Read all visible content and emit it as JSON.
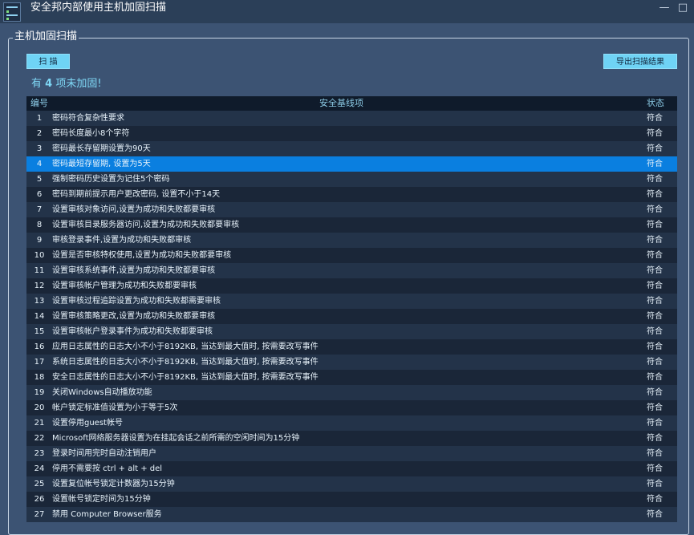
{
  "window": {
    "title": "安全邦内部使用主机加固扫描",
    "minimize_glyph": "—",
    "maximize_glyph": "□"
  },
  "icons": {
    "app": "app-shield-list-icon"
  },
  "colors": {
    "background": "#3c5373",
    "titlebar": "#2b3f58",
    "accent_button": "#6fd3f5",
    "selected_row": "#0a7fe0",
    "summary_text": "#7fd8f6"
  },
  "group": {
    "title": "主机加固扫描"
  },
  "toolbar": {
    "scan_label": "扫  描",
    "export_label": "导出扫描结果"
  },
  "summary": {
    "prefix": "有 ",
    "count": "4",
    "suffix": " 项未加固!"
  },
  "table": {
    "headers": {
      "no": "编号",
      "item": "安全基线项",
      "status": "状态"
    },
    "selected_index": 3,
    "rows": [
      {
        "no": "1",
        "item": "密码符合复杂性要求",
        "status": "符合"
      },
      {
        "no": "2",
        "item": "密码长度最小8个字符",
        "status": "符合"
      },
      {
        "no": "3",
        "item": "密码最长存留期设置为90天",
        "status": "符合"
      },
      {
        "no": "4",
        "item": "密码最短存留期, 设置为5天",
        "status": "符合"
      },
      {
        "no": "5",
        "item": "强制密码历史设置为记住5个密码",
        "status": "符合"
      },
      {
        "no": "6",
        "item": "密码到期前提示用户更改密码, 设置不小于14天",
        "status": "符合"
      },
      {
        "no": "7",
        "item": "设置审核对象访问,设置为成功和失败都要审核",
        "status": "符合"
      },
      {
        "no": "8",
        "item": "设置审核目录服务器访问,设置为成功和失败都要审核",
        "status": "符合"
      },
      {
        "no": "9",
        "item": "审核登录事件,设置为成功和失败都审核",
        "status": "符合"
      },
      {
        "no": "10",
        "item": "设置是否审核特权使用,设置为成功和失败都要审核",
        "status": "符合"
      },
      {
        "no": "11",
        "item": "设置审核系统事件,设置为成功和失败都要审核",
        "status": "符合"
      },
      {
        "no": "12",
        "item": "设置审核帐户管理为成功和失败都要审核",
        "status": "符合"
      },
      {
        "no": "13",
        "item": "设置审核过程追踪设置为成功和失败都需要审核",
        "status": "符合"
      },
      {
        "no": "14",
        "item": "设置审核策略更改,设置为成功和失败都要审核",
        "status": "符合"
      },
      {
        "no": "15",
        "item": "设置审核帐户登录事件为成功和失败都要审核",
        "status": "符合"
      },
      {
        "no": "16",
        "item": "应用日志属性的日志大小不小于8192KB, 当达到最大值时, 按需要改写事件",
        "status": "符合"
      },
      {
        "no": "17",
        "item": "系统日志属性的日志大小不小于8192KB, 当达到最大值时, 按需要改写事件",
        "status": "符合"
      },
      {
        "no": "18",
        "item": "安全日志属性的日志大小不小于8192KB, 当达到最大值时, 按需要改写事件",
        "status": "符合"
      },
      {
        "no": "19",
        "item": "关闭Windows自动播放功能",
        "status": "符合"
      },
      {
        "no": "20",
        "item": "帐户锁定标准值设置为小于等于5次",
        "status": "符合"
      },
      {
        "no": "21",
        "item": "设置停用guest帐号",
        "status": "符合"
      },
      {
        "no": "22",
        "item": "Microsoft网络服务器设置为在挂起会话之前所需的空闲时间为15分钟",
        "status": "符合"
      },
      {
        "no": "23",
        "item": "登录时间用完时自动注销用户",
        "status": "符合"
      },
      {
        "no": "24",
        "item": "停用不需要按 ctrl + alt + del",
        "status": "符合"
      },
      {
        "no": "25",
        "item": "设置复位帐号锁定计数器为15分钟",
        "status": "符合"
      },
      {
        "no": "26",
        "item": "设置帐号锁定时间为15分钟",
        "status": "符合"
      },
      {
        "no": "27",
        "item": "禁用 Computer Browser服务",
        "status": "符合"
      }
    ]
  }
}
